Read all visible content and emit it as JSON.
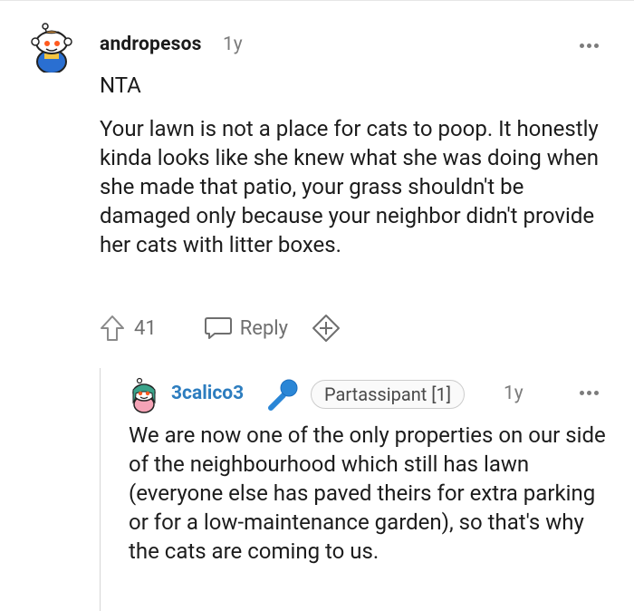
{
  "comment": {
    "username": "andropesos",
    "age": "1y",
    "paragraphs": [
      "NTA",
      "Your lawn is not a place for cats to poop. It honestly kinda looks like she knew what she was doing when she made that patio, your grass shouldn't be damaged only because your neighbor didn't provide her cats with litter boxes."
    ],
    "votes": "41",
    "reply_label": "Reply",
    "icons": {
      "avatar": "snoo-avatar",
      "more": "more-dots-icon",
      "upvote": "upvote-arrow-icon",
      "reply": "speech-bubble-icon",
      "award": "add-award-icon"
    }
  },
  "reply": {
    "username": "3calico3",
    "flair": "Partassipant [1]",
    "age": "1y",
    "body": "We are now one of the only properties on our side of the neighbourhood which still has lawn (everyone else has paved theirs for extra parking or for a low-maintenance garden), so that's why the cats are coming to us.",
    "icons": {
      "avatar": "snoo-avatar",
      "badge": "microphone-icon",
      "more": "more-dots-icon"
    }
  },
  "colors": {
    "username_link": "#2d7dbf",
    "meta_gray": "#7c7c7c",
    "text": "#1c1c1c",
    "mic_blue": "#2a86d6"
  }
}
